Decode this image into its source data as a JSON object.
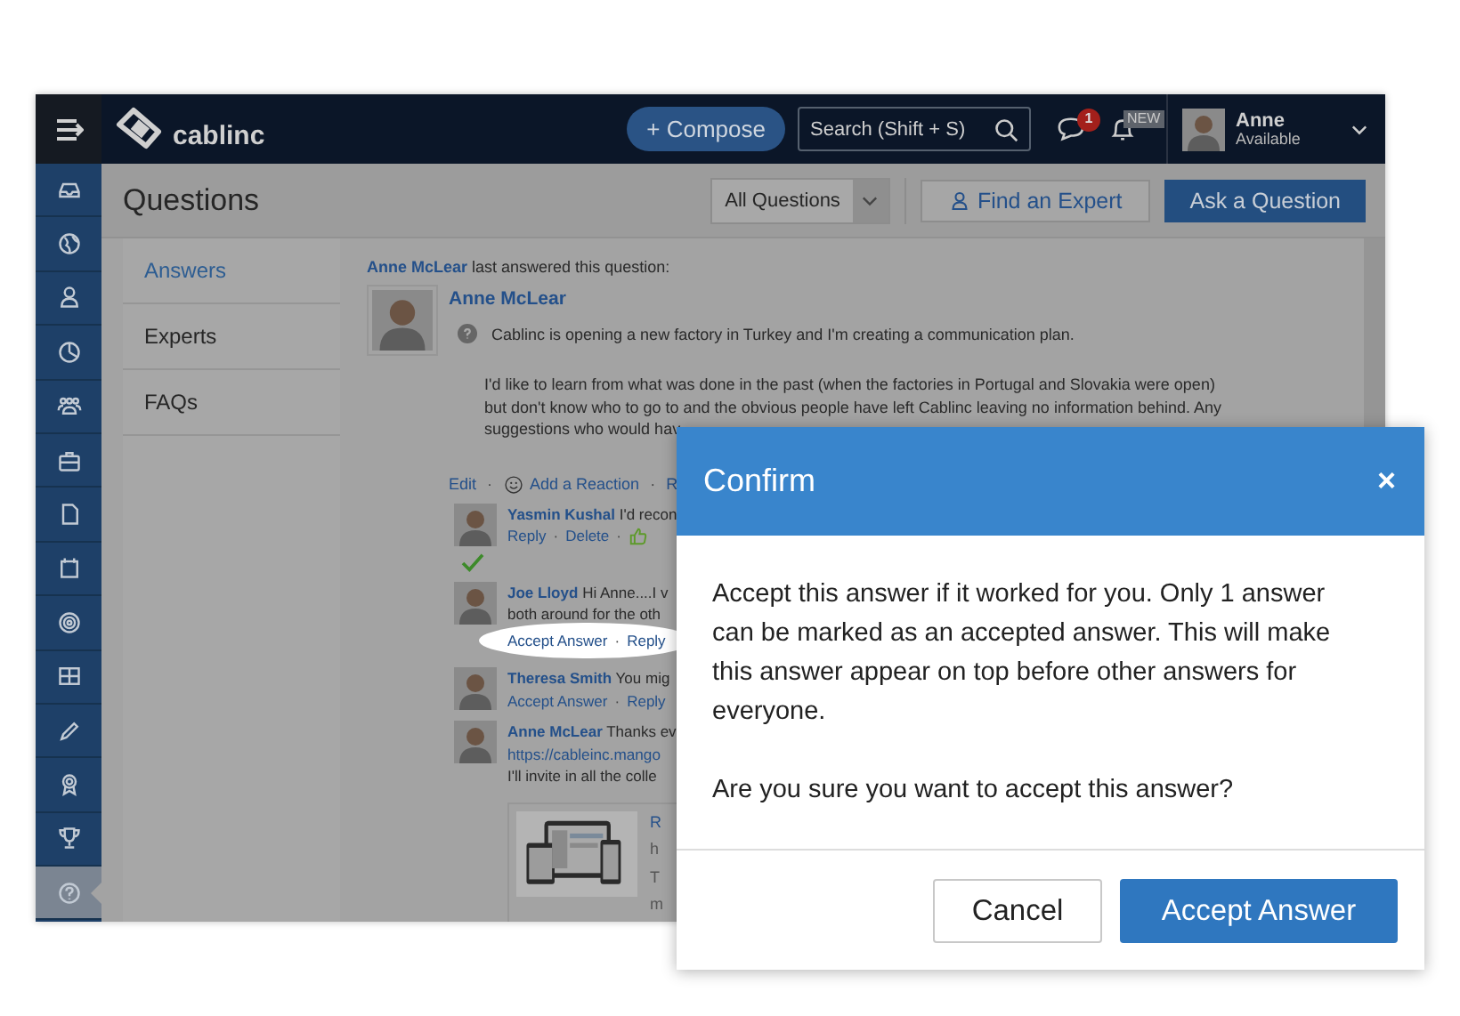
{
  "app": {
    "logo": "cablinc",
    "compose": "+ Compose",
    "search_placeholder": "Search (Shift + S)",
    "chat_badge": "1",
    "new_badge": "NEW",
    "user": {
      "name": "Anne",
      "status": "Available"
    },
    "sidebar": [
      {
        "kind": "inbox",
        "selected": false
      },
      {
        "kind": "globe",
        "selected": false
      },
      {
        "kind": "person",
        "selected": false
      },
      {
        "kind": "pie",
        "selected": false
      },
      {
        "kind": "group",
        "selected": false
      },
      {
        "kind": "briefcase",
        "selected": false
      },
      {
        "kind": "file",
        "selected": false
      },
      {
        "kind": "calendar",
        "selected": false
      },
      {
        "kind": "target",
        "selected": false
      },
      {
        "kind": "grid",
        "selected": false
      },
      {
        "kind": "pencil",
        "selected": false
      },
      {
        "kind": "award",
        "selected": false
      },
      {
        "kind": "trophy",
        "selected": false
      },
      {
        "kind": "help",
        "selected": true
      }
    ],
    "page_title": "Questions",
    "filter": "All Questions",
    "find_expert": "Find an Expert",
    "ask": "Ask a Question",
    "nav": [
      {
        "label": "Answers",
        "selected": true
      },
      {
        "label": "Experts",
        "selected": false
      },
      {
        "label": "FAQs",
        "selected": false
      }
    ],
    "last_answered": {
      "name": "Anne McLear",
      "text": "last answered this question:"
    },
    "question": {
      "author": "Anne McLear",
      "title": "Cablinc is opening a new factory in Turkey and I'm creating a communication plan.",
      "body": [
        "I'd like to learn from what was done in the past (when the factories in Portugal and Slovakia were open)",
        "but don't know who to go to and the obvious people have left Cablinc leaving no information behind. Any",
        "suggestions who would hav"
      ]
    },
    "separator": "·",
    "question_actions": [
      {
        "label": "Edit",
        "kind": "link"
      },
      {
        "label": "Add a Reaction",
        "kind": "reaction"
      },
      {
        "label": "R",
        "kind": "link"
      }
    ],
    "comments": [
      {
        "author": "Yasmin Kushal",
        "lines": [
          "I'd recon"
        ],
        "actions": [
          "Reply",
          "Delete"
        ],
        "liked": true,
        "accepted": true,
        "spotlight": false
      },
      {
        "author": "Joe Lloyd",
        "lines": [
          "Hi Anne....I v",
          "both around for the oth"
        ],
        "actions": [
          "Accept Answer",
          "Reply"
        ],
        "liked": false,
        "accepted": false,
        "spotlight": true
      },
      {
        "author": "Theresa Smith",
        "lines": [
          "You mig"
        ],
        "actions": [
          "Accept Answer",
          "Reply"
        ],
        "liked": false,
        "accepted": false,
        "spotlight": false
      },
      {
        "author": "Anne McLear",
        "lines": [
          "Thanks ev"
        ],
        "link": "https://cableinc.mango",
        "extra": "I'll invite in all the colle",
        "preview": {
          "kind": "picture",
          "lines": [
            "R",
            "h",
            "T",
            "m"
          ]
        },
        "liked": false,
        "accepted": false,
        "spotlight": false
      }
    ]
  },
  "dialog": {
    "title": "Confirm",
    "close": "×",
    "message": "Accept this answer if it worked for you. Only 1 answer can be marked as an accepted answer. This will make this answer appear on top before other answers for everyone.",
    "question": "Are you sure you want to accept this answer?",
    "buttons": [
      {
        "label": "Cancel",
        "kind": "secondary"
      },
      {
        "label": "Accept Answer",
        "kind": "primary"
      }
    ]
  }
}
